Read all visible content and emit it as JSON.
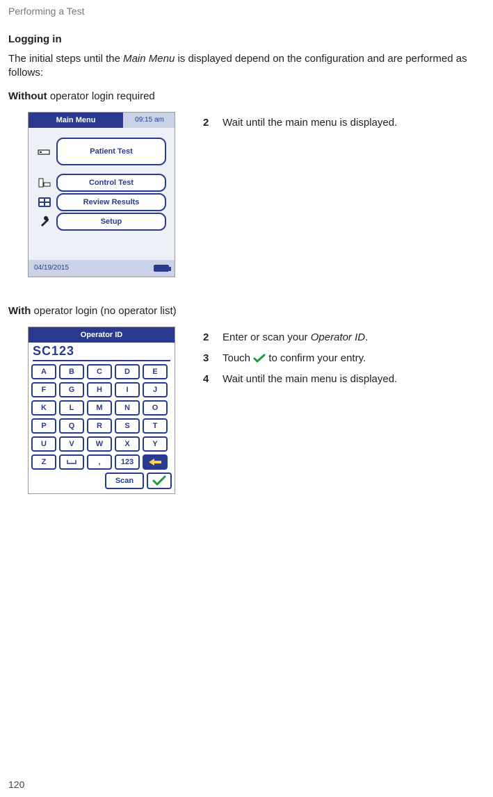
{
  "header": "Performing a Test",
  "section_title": "Logging in",
  "intro_part1": "The initial steps until the ",
  "intro_em": "Main Menu",
  "intro_part2": " is displayed depend on the configuration and are performed as follows:",
  "subhead1_bold": "Without",
  "subhead1_rest": " operator login required",
  "device1": {
    "title": "Main Menu",
    "time": "09:15 am",
    "patient_test": "Patient Test",
    "control_test": "Control Test",
    "review_results": "Review Results",
    "setup": "Setup",
    "date": "04/19/2015"
  },
  "steps1": {
    "s2_num": "2",
    "s2_text": "Wait until the main menu is displayed."
  },
  "subhead2_bold": "With",
  "subhead2_rest": " operator login (no operator list)",
  "device2": {
    "title": "Operator ID",
    "entry": "SC123",
    "keys": {
      "r1": [
        "A",
        "B",
        "C",
        "D",
        "E"
      ],
      "r2": [
        "F",
        "G",
        "H",
        "I",
        "J"
      ],
      "r3": [
        "K",
        "L",
        "M",
        "N",
        "O"
      ],
      "r4": [
        "P",
        "Q",
        "R",
        "S",
        "T"
      ],
      "r5": [
        "U",
        "V",
        "W",
        "X",
        "Y"
      ],
      "r6": [
        "Z",
        "",
        ",",
        "123"
      ]
    },
    "scan": "Scan"
  },
  "steps2": {
    "s2_num": "2",
    "s2_text_a": "Enter or scan your ",
    "s2_em": "Operator ID",
    "s2_text_b": ".",
    "s3_num": "3",
    "s3_text_a": "Touch ",
    "s3_text_b": " to confirm your entry.",
    "s4_num": "4",
    "s4_text": "Wait until the main menu is displayed."
  },
  "page_number": "120"
}
